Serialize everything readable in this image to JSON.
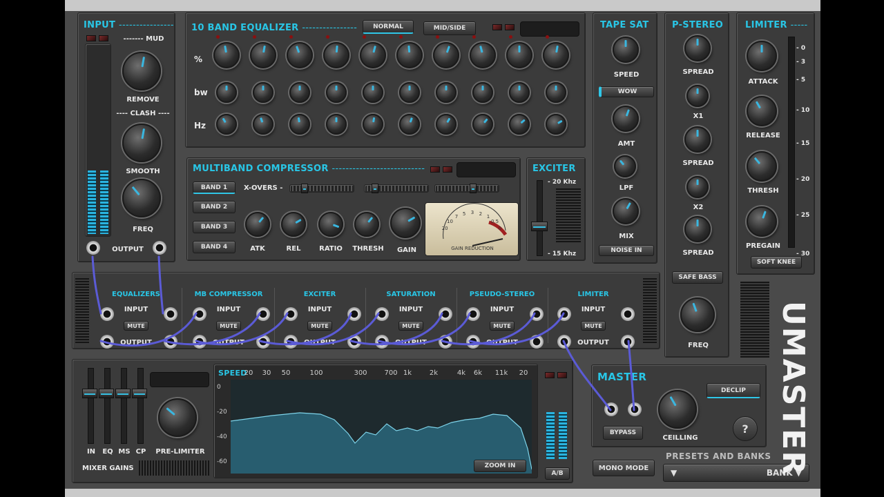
{
  "colors": {
    "accent": "#29c6e6",
    "panel": "#3b3b3b",
    "cable": "#5858c8"
  },
  "input": {
    "title": "INPUT",
    "mud": "MUD",
    "remove": "REMOVE",
    "clash": "CLASH",
    "smooth": "SMOOTH",
    "freq": "FREQ",
    "output": "OUTPUT"
  },
  "eq": {
    "title": "10 BAND EQUALIZER",
    "normal": "NORMAL",
    "midside": "MID/SIDE",
    "rows": [
      "%",
      "bw",
      "Hz"
    ]
  },
  "mbc": {
    "title": "MULTIBAND COMPRESSOR",
    "bands": [
      "BAND 1",
      "BAND 2",
      "BAND 3",
      "BAND 4"
    ],
    "xovers": "X-OVERS -",
    "knobs": [
      "ATK",
      "REL",
      "RATIO",
      "THRESH",
      "GAIN"
    ],
    "vu_label": "GAIN REDUCTION",
    "vu_scale": [
      "20",
      "10",
      "7",
      "5",
      "3",
      "2",
      "1",
      "0.5",
      "0"
    ]
  },
  "exciter": {
    "title": "EXCITER",
    "top": "- 20 Khz",
    "bottom": "- 15 Khz"
  },
  "tape": {
    "title": "TAPE SAT",
    "speed": "SPEED",
    "wow": "WOW",
    "amt": "AMT",
    "lpf": "LPF",
    "mix": "MIX",
    "noise": "NOISE IN"
  },
  "pstereo": {
    "title": "P-STEREO",
    "labels": [
      "SPREAD",
      "X1",
      "SPREAD",
      "X2",
      "SPREAD"
    ],
    "safe_bass": "SAFE BASS",
    "freq": "FREQ"
  },
  "limiter": {
    "title": "LIMITER",
    "labels": [
      "ATTACK",
      "RELEASE",
      "THRESH",
      "PREGAIN"
    ],
    "scale": [
      "- 0",
      "- 3",
      "- 5",
      "- 10",
      "- 15",
      "- 20",
      "- 25",
      "- 30"
    ],
    "soft_knee": "SOFT KNEE"
  },
  "routing": {
    "modules": [
      "EQUALIZERS",
      "MB COMPRESSOR",
      "EXCITER",
      "SATURATION",
      "PSEUDO-STEREO",
      "LIMITER"
    ],
    "input": "INPUT",
    "output": "OUTPUT",
    "mute": "MUTE"
  },
  "mixer": {
    "faders": [
      "IN",
      "EQ",
      "MS",
      "CP"
    ],
    "pre_limiter": "PRE-LIMITER",
    "title": "MIXER GAINS"
  },
  "analyzer": {
    "speed": "SPEED",
    "freqs": [
      "20",
      "30",
      "50",
      "100",
      "300",
      "700",
      "1k",
      "2k",
      "4k",
      "6k",
      "11k",
      "20"
    ],
    "db": [
      "0",
      "-20",
      "-40",
      "-60"
    ],
    "zoom": "ZOOM IN",
    "ab": "A/B"
  },
  "master": {
    "title": "MASTER",
    "bypass": "BYPASS",
    "ceiling": "CEILLING",
    "declip": "DECLIP",
    "help": "?",
    "presets": "PRESETS AND BANKS",
    "mono": "MONO MODE",
    "bank": "BANK ▼",
    "arrow": "▼",
    "brand": "UMASTER"
  }
}
